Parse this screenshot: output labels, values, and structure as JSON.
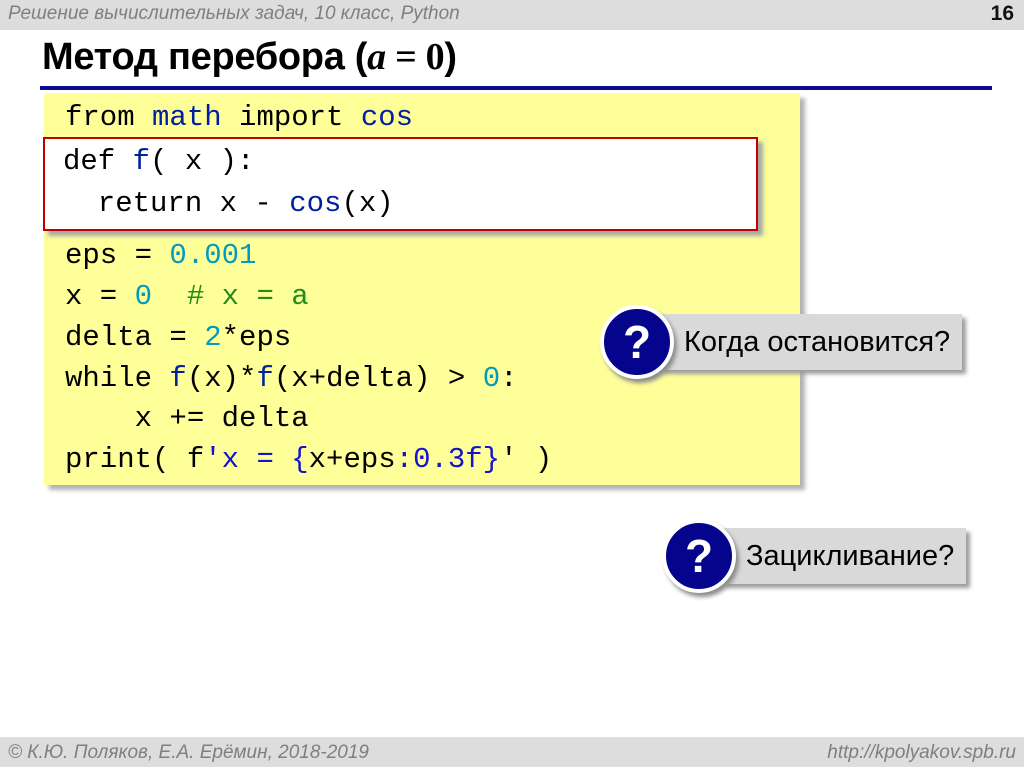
{
  "header": {
    "course": "Решение  вычислительных задач, 10 класс, Python",
    "page_number": "16"
  },
  "title": {
    "prefix": "Метод перебора (",
    "var": "a",
    "middle": " = ",
    "value": "0",
    "suffix": ")"
  },
  "code": {
    "l1_from": "from ",
    "l1_mod": "math",
    "l1_import": " import ",
    "l1_name": "cos",
    "l2_def": "def ",
    "l2_f": "f",
    "l2_rest": "( x ):",
    "l3_return": "  return x - ",
    "l3_cos": "cos",
    "l3_rest": "(x)",
    "l4_eps": "eps = ",
    "l4_val": "0.001",
    "l5_x": "x = ",
    "l5_val": "0",
    "l5_comment": "  # x = a",
    "l6_delta": "delta = ",
    "l6_two": "2",
    "l6_rest": "*eps",
    "l7_while": "while ",
    "l7_f1": "f",
    "l7_mid": "(x)*",
    "l7_f2": "f",
    "l7_rest": "(x+delta) > ",
    "l7_zero": "0",
    "l7_colon": ":",
    "l8_body": "    x += delta",
    "l9_print": "print( f",
    "l9_str1": "'x = {",
    "l9_expr": "x+eps",
    "l9_str2": ":0.3f}",
    "l9_q": "'",
    "l9_end": " )"
  },
  "callouts": {
    "q1_symbol": "?",
    "q1_text": "Когда остановится?",
    "q2_symbol": "?",
    "q2_text": "Зацикливание?"
  },
  "footer": {
    "authors": "© К.Ю. Поляков, Е.А. Ерёмин, 2018-2019",
    "url": "http://kpolyakov.spb.ru"
  },
  "colors": {
    "code_background": "#ffff99",
    "title_rule": "#0b0b8c",
    "badge": "#04048c",
    "highlight_border": "#c00000"
  }
}
